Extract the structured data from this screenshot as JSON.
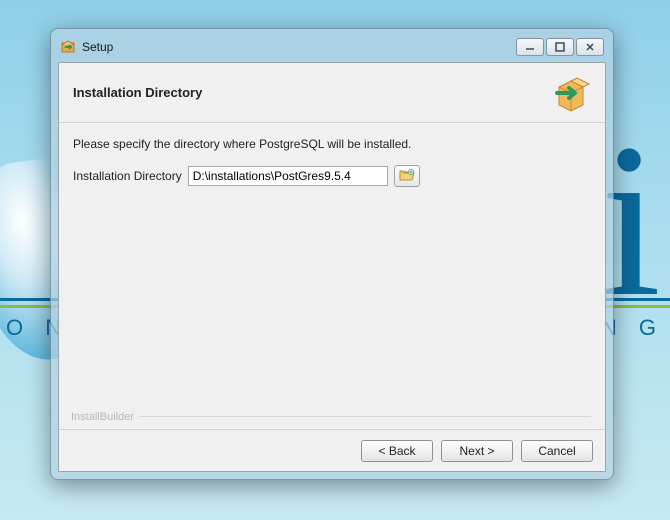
{
  "background": {
    "left_text": "O N S",
    "right_text": "N G"
  },
  "window": {
    "title": "Setup",
    "header": "Installation Directory",
    "instruction": "Please specify the directory where PostgreSQL will be installed.",
    "field_label": "Installation Directory",
    "field_value": "D:\\installations\\PostGres9.5.4",
    "watermark": "InstallBuilder",
    "buttons": {
      "back": "< Back",
      "next": "Next >",
      "cancel": "Cancel"
    }
  }
}
